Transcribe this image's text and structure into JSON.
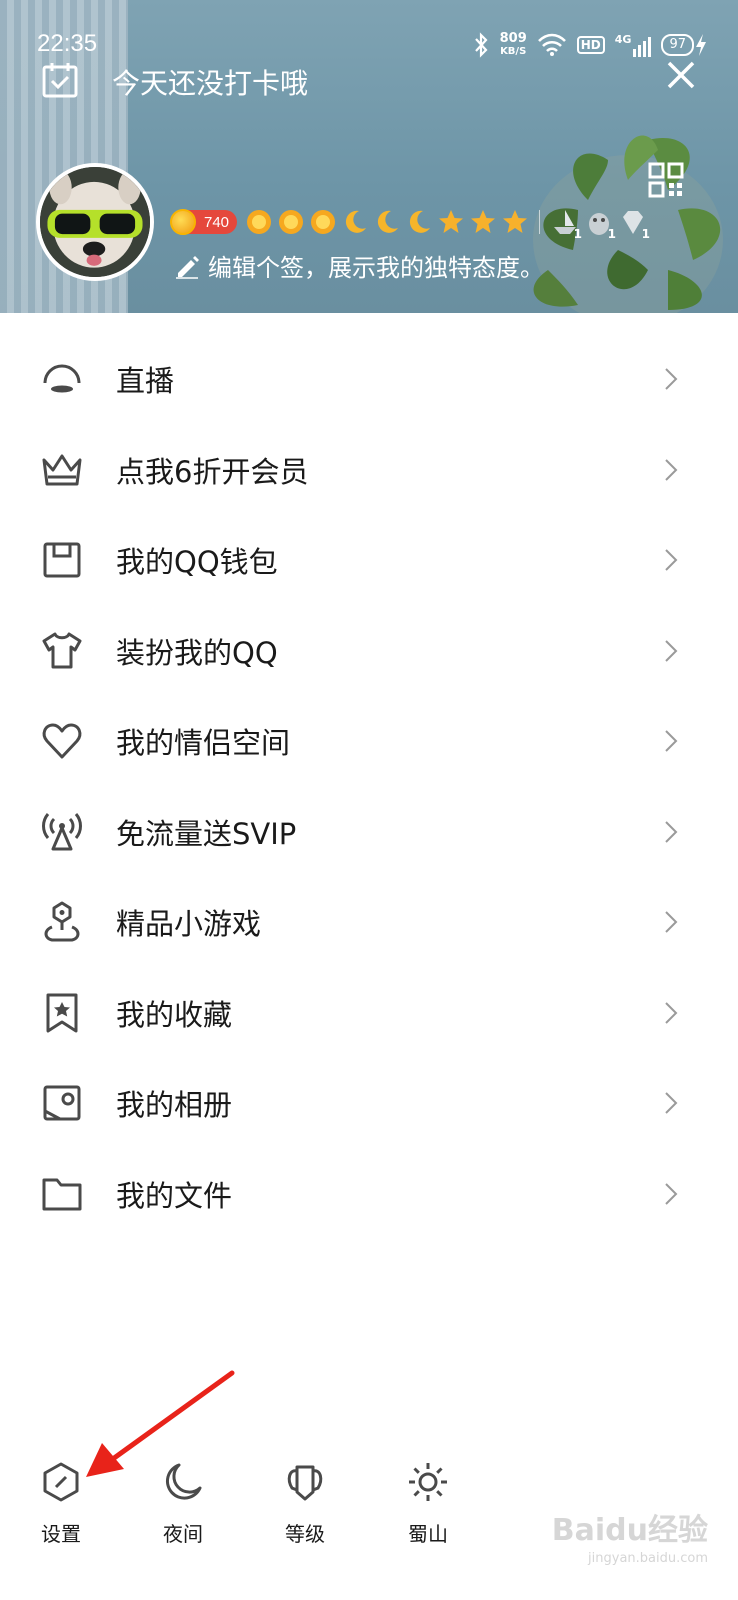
{
  "status_bar": {
    "time": "22:35",
    "net_speed_value": "809",
    "net_speed_unit": "KB/S",
    "hd": "HD",
    "network": "4G",
    "battery": "97"
  },
  "header": {
    "checkin_text": "今天还没打卡哦",
    "level_value": "740",
    "badge_counts": [
      "1",
      "1",
      "1"
    ],
    "signature": "编辑个签，展示我的独特态度。"
  },
  "menu": {
    "items": [
      {
        "label": "直播",
        "icon": "live-icon"
      },
      {
        "label": "点我6折开会员",
        "icon": "crown-icon"
      },
      {
        "label": "我的QQ钱包",
        "icon": "wallet-icon"
      },
      {
        "label": "装扮我的QQ",
        "icon": "tshirt-icon"
      },
      {
        "label": "我的情侣空间",
        "icon": "heart-icon"
      },
      {
        "label": "免流量送SVIP",
        "icon": "signal-tower-icon"
      },
      {
        "label": "精品小游戏",
        "icon": "game-pin-icon"
      },
      {
        "label": "我的收藏",
        "icon": "bookmark-star-icon"
      },
      {
        "label": "我的相册",
        "icon": "photo-icon"
      },
      {
        "label": "我的文件",
        "icon": "folder-icon"
      }
    ]
  },
  "bottom_bar": {
    "settings": "设置",
    "night": "夜间",
    "level": "等级",
    "shushan": "蜀山"
  },
  "colors": {
    "header_bg": "#6d95a7",
    "level_pill": "#e5483c",
    "arrow": "#e8231a",
    "text": "#1a1a1a",
    "icon": "#4a4a4a"
  },
  "watermark": {
    "brand": "Baidu经验",
    "url": "jingyan.baidu.com"
  }
}
